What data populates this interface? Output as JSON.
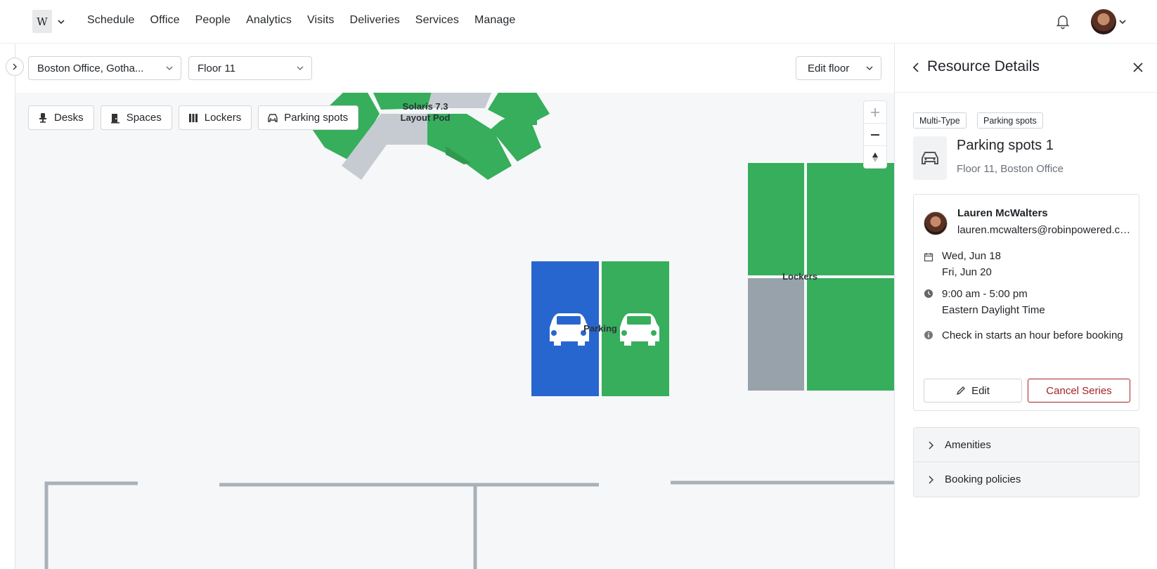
{
  "nav": {
    "logo_text": "W",
    "links": [
      "Schedule",
      "Office",
      "People",
      "Analytics",
      "Visits",
      "Deliveries",
      "Services",
      "Manage"
    ]
  },
  "filters": {
    "office": "Boston Office, Gotha...",
    "floor": "Floor 11",
    "edit_floor": "Edit floor"
  },
  "chips": [
    "Desks",
    "Spaces",
    "Lockers",
    "Parking spots"
  ],
  "map": {
    "pod_label_1": "Solaris 7.3",
    "pod_label_2": "Layout Pod",
    "parking_label": "Parking",
    "lockers_label": "Lockers",
    "colors": {
      "available": "#36ae5b",
      "booked": "#2866cf",
      "unavailable": "#c5cbd1",
      "locked": "#98a2ab"
    }
  },
  "panel": {
    "title": "Resource Details",
    "tags": [
      "Multi-Type",
      "Parking spots"
    ],
    "resource_name": "Parking spots 1",
    "resource_location": "Floor 11, Boston Office",
    "booking": {
      "name": "Lauren McWalters",
      "email": "lauren.mcwalters@robinpowered.com",
      "date_start": "Wed, Jun 18",
      "date_end": "Fri, Jun 20",
      "time": "9:00 am - 5:00 pm",
      "timezone": "Eastern Daylight Time",
      "note": "Check in starts an hour before booking",
      "edit_label": "Edit",
      "cancel_label": "Cancel Series"
    },
    "accordions": [
      "Amenities",
      "Booking policies"
    ]
  }
}
